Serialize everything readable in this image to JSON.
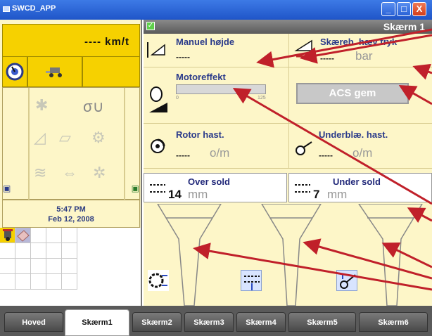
{
  "window": {
    "title": "SWCD_APP",
    "minimize": "_",
    "maximize": "□",
    "close": "X"
  },
  "left_panel": {
    "speed_value": "---- km/t",
    "time": "5:47 PM",
    "date": "Feb 12, 2008"
  },
  "main": {
    "screen_title": "Skærm 1",
    "manuel_hojde": {
      "label": "Manuel højde",
      "value": "-----"
    },
    "skaereb": {
      "label": "Skæreb. hæv tryk",
      "value": "-----",
      "unit": "bar"
    },
    "motoreffekt": {
      "label": "Motoreffekt",
      "min_tick": "0",
      "max_tick": "125",
      "level": 0
    },
    "acs_button": {
      "label": "ACS gem"
    },
    "rotor": {
      "label": "Rotor hast.",
      "value": "-----",
      "unit": "o/m"
    },
    "underblae": {
      "label": "Underblæ. hast.",
      "value": "-----",
      "unit": "o/m"
    },
    "over_sold": {
      "label": "Over sold",
      "value": "14",
      "unit": "mm"
    },
    "under_sold": {
      "label": "Under sold",
      "value": "7",
      "unit": "mm"
    }
  },
  "tabs": [
    {
      "label": "Hoved"
    },
    {
      "label": "Skærm1"
    },
    {
      "label": "Skærm2"
    },
    {
      "label": "Skærm3"
    },
    {
      "label": "Skærm4"
    },
    {
      "label": "Skærm5"
    },
    {
      "label": "Skærm6"
    }
  ],
  "colors": {
    "title_bar": "#1f55c8",
    "speed_box": "#f6d100",
    "panel_bg": "#fdf6c8",
    "arrow": "#c0202a",
    "label": "#2a3a8a"
  }
}
